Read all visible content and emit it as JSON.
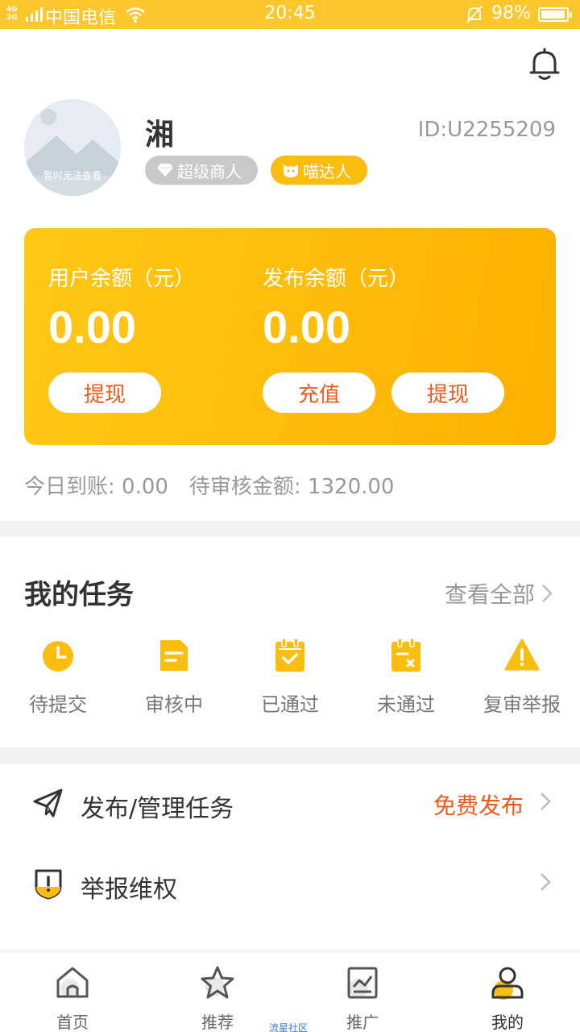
{
  "status_bar": {
    "network": "4G\n2G",
    "carrier": "中国电信",
    "time": "20:45",
    "battery": "98%",
    "battery_level": 0.98
  },
  "profile": {
    "avatar_placeholder": "暂时无法查看",
    "name": "湘",
    "id": "ID:U2255209",
    "badges": [
      "超级商人",
      "喵达人"
    ]
  },
  "balance": {
    "user": {
      "label": "用户余额（元）",
      "amount": "0.00",
      "withdraw": "提现"
    },
    "publish": {
      "label": "发布余额（元）",
      "amount": "0.00",
      "recharge": "充值",
      "withdraw": "提现"
    }
  },
  "summary": {
    "today": "今日到账: 0.00",
    "pending": "待审核金额: 1320.00"
  },
  "tasks": {
    "title": "我的任务",
    "view_all": "查看全部",
    "items": [
      "待提交",
      "审核中",
      "已通过",
      "未通过",
      "复审举报"
    ]
  },
  "menu": {
    "publish": {
      "label": "发布/管理任务",
      "extra": "免费发布"
    },
    "report": {
      "label": "举报维权"
    }
  },
  "tabbar": {
    "items": [
      "首页",
      "推荐",
      "推广",
      "我的"
    ],
    "watermark": "流星社区"
  },
  "colors": {
    "accent": "#fcc62c",
    "orange": "#f05a1a",
    "icon_yellow": "#fbbd10"
  }
}
